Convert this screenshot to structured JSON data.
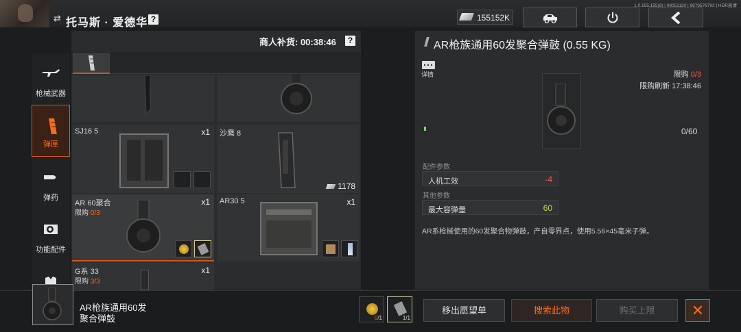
{
  "player": {
    "name": "托马斯 · 爱德华",
    "help": "?"
  },
  "version_text": "1.0.155.155(9) | 08051120 | 9879576792 | HDR高清",
  "currency": {
    "amount": "155152K"
  },
  "top_buttons": [
    "vehicle-icon",
    "power-icon",
    "back-arrow-icon"
  ],
  "sidebar": {
    "items": [
      {
        "label": "枪械武器",
        "icon": "rifle-icon"
      },
      {
        "label": "弹匣",
        "icon": "magazine-icon",
        "active": true
      },
      {
        "label": "弹药",
        "icon": "bullet-icon"
      },
      {
        "label": "功能配件",
        "icon": "scope-icon"
      },
      {
        "label": "",
        "icon": "armor-icon"
      }
    ]
  },
  "shop": {
    "restock_label": "商人补货: 00:38:46",
    "help": "?",
    "items": [
      {
        "name": "",
        "qty": ""
      },
      {
        "name": "",
        "qty": ""
      },
      {
        "name": "SJ16 5",
        "qty": "x1"
      },
      {
        "name": "沙鹰 8",
        "qty": "",
        "price": "1178"
      },
      {
        "name": "AR 60聚合",
        "qty": "x1",
        "limit_label": "限购 ",
        "limit_value": "0/3"
      },
      {
        "name": "AR30 5",
        "qty": "x1"
      },
      {
        "name": "G系 33",
        "qty": "x1",
        "limit_label": "限购 ",
        "limit_value": "3/3"
      }
    ]
  },
  "detail": {
    "title": "AR枪族通用60发聚合弹鼓 (0.55 KG)",
    "info_label": "详情",
    "limit_label": "限购 ",
    "limit_value": "0/3",
    "refresh": "限购刷新 17:38:46",
    "stock": "0/60",
    "section_attach": "配件参数",
    "params_attach": [
      {
        "key": "人机工效",
        "value": "-4",
        "color": "#ff5a4a"
      }
    ],
    "section_other": "其他参数",
    "params_other": [
      {
        "key": "最大容弹量",
        "value": "60",
        "color": "#b5e04a"
      }
    ],
    "description": "AR系枪械使用的60发聚合物弹鼓，产自零界点，使用5.56×45毫米子弹。"
  },
  "bottom": {
    "item_name_line1": "AR枪族通用60发",
    "item_name_line2": "聚合弹鼓",
    "costs": [
      {
        "icon": "gold-coin-icon",
        "have": "0",
        "need": "/1"
      },
      {
        "icon": "magazine-pouch-icon",
        "have": "1",
        "need": "/1"
      }
    ],
    "buttons": {
      "remove_wishlist": "移出愿望单",
      "search": "搜索此物",
      "buy_limit": "购买上限"
    },
    "close": "✕"
  },
  "colors": {
    "accent": "#d2561d",
    "accent_text": "#ff6a1a"
  }
}
